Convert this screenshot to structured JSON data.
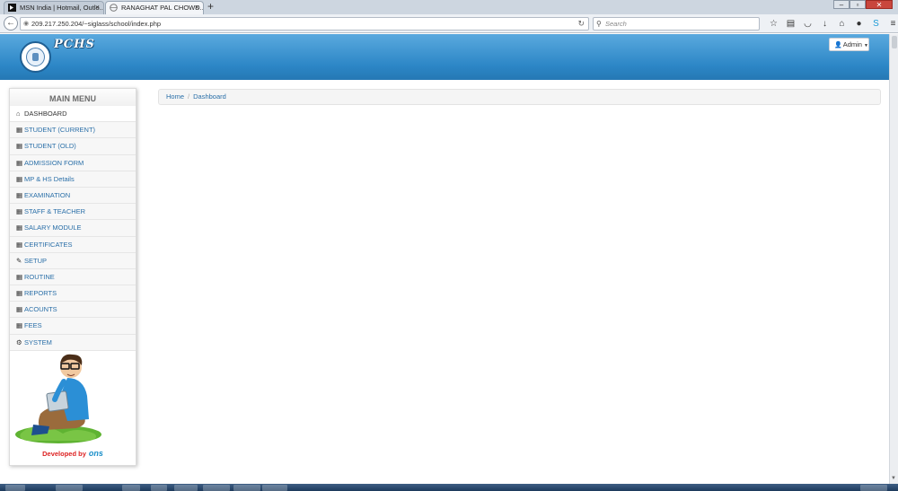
{
  "browser": {
    "tabs": [
      {
        "label": "MSN India | Hotmail, Outlo...",
        "active": false
      },
      {
        "label": "RANAGHAT PAL CHOWD...",
        "active": true
      }
    ],
    "new_tab": "+",
    "url": "209.217.250.204/~siglass/school/index.php",
    "search_placeholder": "Search"
  },
  "header": {
    "school_abbr": "PCHS",
    "admin_label": "Admin"
  },
  "sidebar": {
    "title": "MAIN MENU",
    "items": [
      {
        "label": "DASHBOARD",
        "icon": "home-icon",
        "glyph": "⌂",
        "active": true
      },
      {
        "label": "STUDENT (CURRENT)",
        "icon": "grid-icon",
        "glyph": "▦"
      },
      {
        "label": "STUDENT (OLD)",
        "icon": "grid-icon",
        "glyph": "▦"
      },
      {
        "label": "ADMISSION FORM",
        "icon": "grid-icon",
        "glyph": "▦"
      },
      {
        "label": "MP & HS Details",
        "icon": "grid-icon",
        "glyph": "▦"
      },
      {
        "label": "EXAMINATION",
        "icon": "grid-icon",
        "glyph": "▦"
      },
      {
        "label": "STAFF & TEACHER",
        "icon": "grid-icon",
        "glyph": "▦"
      },
      {
        "label": "SALARY MODULE",
        "icon": "grid-icon",
        "glyph": "▦"
      },
      {
        "label": "CERTIFICATES",
        "icon": "grid-icon",
        "glyph": "▦"
      },
      {
        "label": "SETUP",
        "icon": "wrench-icon",
        "glyph": "✎"
      },
      {
        "label": "ROUTINE",
        "icon": "grid-icon",
        "glyph": "▦"
      },
      {
        "label": "REPORTS",
        "icon": "grid-icon",
        "glyph": "▦"
      },
      {
        "label": "ACOUNTS",
        "icon": "grid-icon",
        "glyph": "▦"
      },
      {
        "label": "FEES",
        "icon": "grid-icon",
        "glyph": "▦"
      },
      {
        "label": "SYSTEM",
        "icon": "cogs-icon",
        "glyph": "⚙"
      }
    ],
    "developed_by": "Developed by",
    "developer_brand": "ons"
  },
  "breadcrumb": {
    "home": "Home",
    "separator": "/",
    "current": "Dashboard"
  },
  "colors": {
    "header_blue": "#2c86c6",
    "link_blue": "#2a6fa8",
    "developed_red": "#dd2222"
  }
}
